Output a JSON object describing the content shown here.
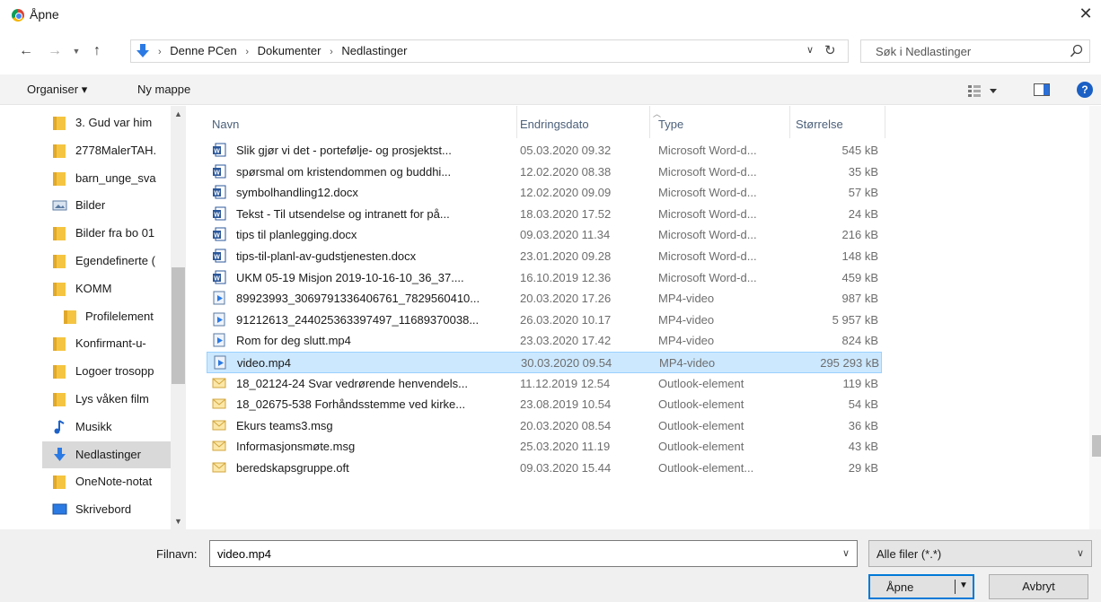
{
  "window": {
    "title": "Åpne",
    "close_glyph": "✕"
  },
  "nav": {
    "back_icon": "back-arrow-icon",
    "forward_icon": "forward-arrow-icon",
    "up_icon": "up-arrow-icon",
    "breadcrumbs": [
      "Denne PCen",
      "Dokumenter",
      "Nedlastinger"
    ],
    "search_placeholder": "Søk i Nedlastinger"
  },
  "toolbar": {
    "organise_label": "Organiser ▾",
    "new_folder_label": "Ny mappe",
    "help_glyph": "?"
  },
  "sidebar": {
    "items": [
      {
        "label": "3. Gud var him",
        "icon": "folder-icon"
      },
      {
        "label": "2778MalerTAH.",
        "icon": "folder-icon"
      },
      {
        "label": "barn_unge_sva",
        "icon": "folder-icon"
      },
      {
        "label": "Bilder",
        "icon": "pictures-icon"
      },
      {
        "label": "Bilder fra bo 01",
        "icon": "folder-icon"
      },
      {
        "label": "Egendefinerte (",
        "icon": "folder-icon"
      },
      {
        "label": "KOMM",
        "icon": "folder-icon"
      },
      {
        "label": "Profilelement",
        "icon": "folder-icon"
      },
      {
        "label": "Konfirmant-u-",
        "icon": "folder-icon"
      },
      {
        "label": "Logoer trosopp",
        "icon": "folder-icon"
      },
      {
        "label": "Lys våken film",
        "icon": "folder-icon"
      },
      {
        "label": "Musikk",
        "icon": "music-icon"
      },
      {
        "label": "Nedlastinger",
        "icon": "downloads-icon"
      },
      {
        "label": "OneNote-notat",
        "icon": "folder-icon"
      },
      {
        "label": "Skrivebord",
        "icon": "desktop-icon"
      }
    ]
  },
  "columns": {
    "name": "Navn",
    "date": "Endringsdato",
    "type": "Type",
    "size": "Størrelse"
  },
  "files": [
    {
      "name": "Slik gjør vi det - portefølje- og prosjektst...",
      "date": "05.03.2020 09.32",
      "type": "Microsoft Word-d...",
      "size": "545 kB",
      "kind": "word"
    },
    {
      "name": "spørsmal om kristendommen og buddhi...",
      "date": "12.02.2020 08.38",
      "type": "Microsoft Word-d...",
      "size": "35 kB",
      "kind": "word"
    },
    {
      "name": "symbolhandling12.docx",
      "date": "12.02.2020 09.09",
      "type": "Microsoft Word-d...",
      "size": "57 kB",
      "kind": "word"
    },
    {
      "name": "Tekst - Til utsendelse og intranett for på...",
      "date": "18.03.2020 17.52",
      "type": "Microsoft Word-d...",
      "size": "24 kB",
      "kind": "word"
    },
    {
      "name": "tips til planlegging.docx",
      "date": "09.03.2020 11.34",
      "type": "Microsoft Word-d...",
      "size": "216 kB",
      "kind": "word"
    },
    {
      "name": "tips-til-planl-av-gudstjenesten.docx",
      "date": "23.01.2020 09.28",
      "type": "Microsoft Word-d...",
      "size": "148 kB",
      "kind": "word"
    },
    {
      "name": "UKM 05-19 Misjon 2019-10-16-10_36_37....",
      "date": "16.10.2019 12.36",
      "type": "Microsoft Word-d...",
      "size": "459 kB",
      "kind": "word"
    },
    {
      "name": "89923993_3069791336406761_7829560410...",
      "date": "20.03.2020 17.26",
      "type": "MP4-video",
      "size": "987 kB",
      "kind": "video"
    },
    {
      "name": "91212613_244025363397497_11689370038...",
      "date": "26.03.2020 10.17",
      "type": "MP4-video",
      "size": "5 957 kB",
      "kind": "video"
    },
    {
      "name": "Rom for deg slutt.mp4",
      "date": "23.03.2020 17.42",
      "type": "MP4-video",
      "size": "824 kB",
      "kind": "video"
    },
    {
      "name": "video.mp4",
      "date": "30.03.2020 09.54",
      "type": "MP4-video",
      "size": "295 293 kB",
      "kind": "video",
      "selected": true
    },
    {
      "name": "18_02124-24 Svar vedrørende henvendels...",
      "date": "11.12.2019 12.54",
      "type": "Outlook-element",
      "size": "119 kB",
      "kind": "mail"
    },
    {
      "name": "18_02675-538 Forhåndsstemme ved kirke...",
      "date": "23.08.2019 10.54",
      "type": "Outlook-element",
      "size": "54 kB",
      "kind": "mail"
    },
    {
      "name": "Ekurs teams3.msg",
      "date": "20.03.2020 08.54",
      "type": "Outlook-element",
      "size": "36 kB",
      "kind": "mail"
    },
    {
      "name": "Informasjonsmøte.msg",
      "date": "25.03.2020 11.19",
      "type": "Outlook-element",
      "size": "43 kB",
      "kind": "mail"
    },
    {
      "name": "beredskapsgruppe.oft",
      "date": "09.03.2020 15.44",
      "type": "Outlook-element...",
      "size": "29 kB",
      "kind": "mail"
    }
  ],
  "footer": {
    "filename_label": "Filnavn:",
    "filename_value": "video.mp4",
    "filter_value": "Alle filer (*.*)",
    "open_label": "Åpne",
    "cancel_label": "Avbryt"
  },
  "colors": {
    "accent": "#0078d7",
    "selection": "#cce8ff",
    "folder": "#f5c542"
  }
}
